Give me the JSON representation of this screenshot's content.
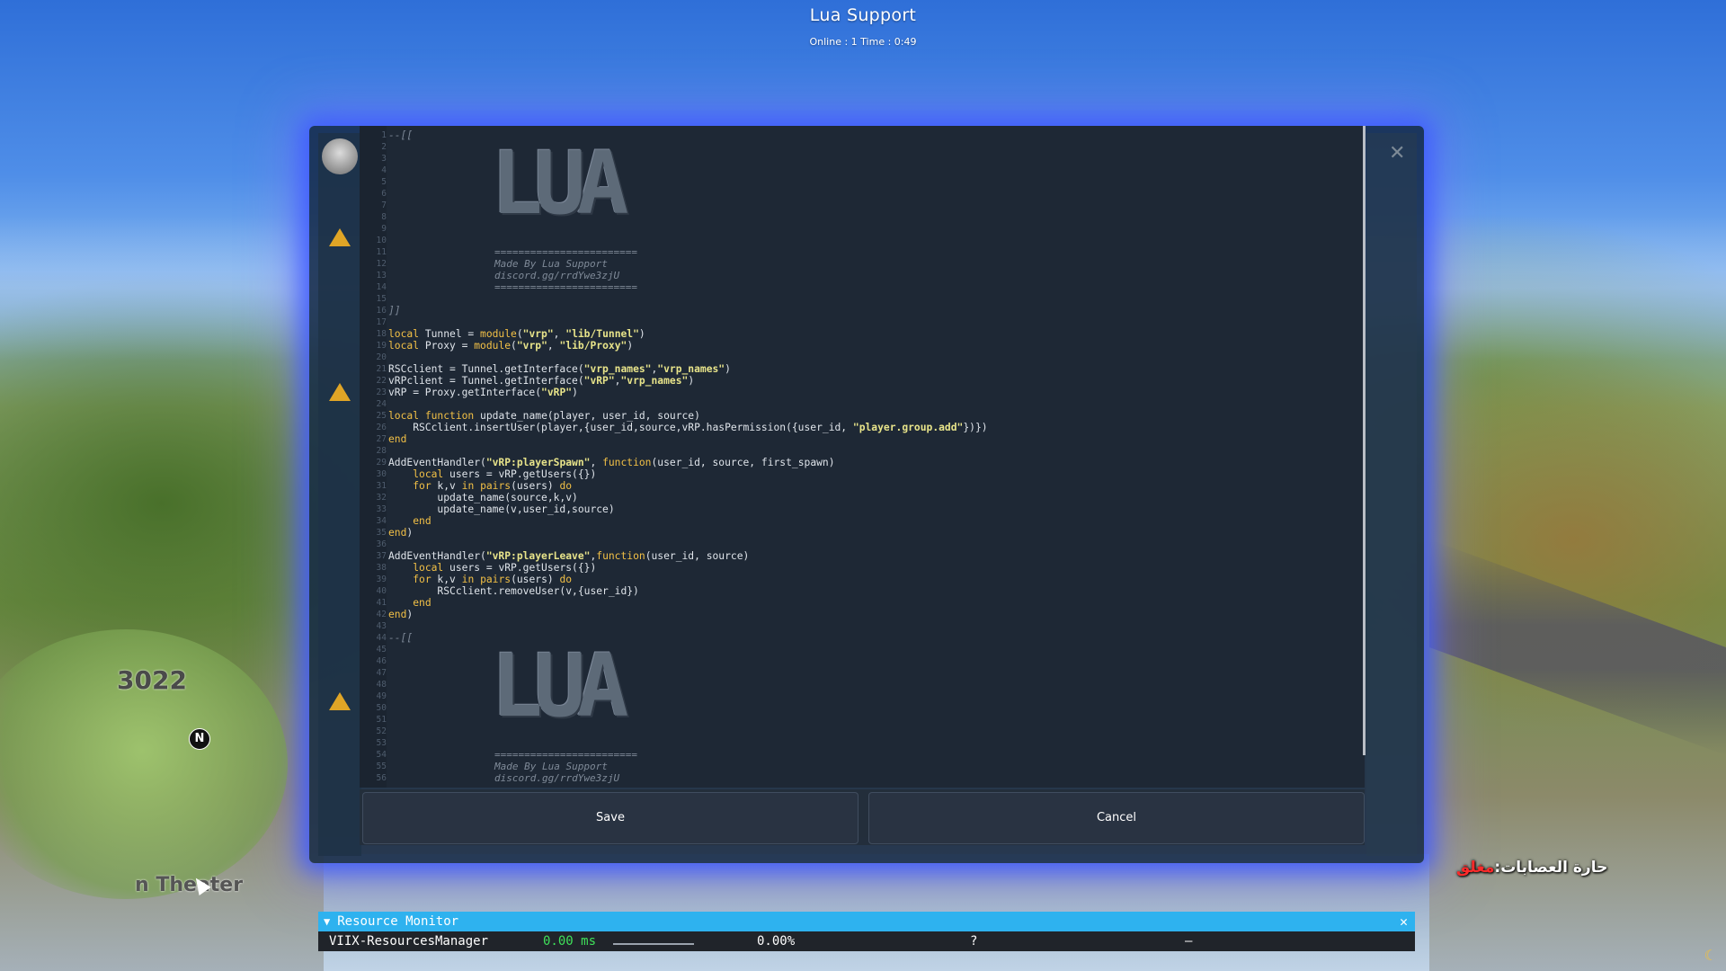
{
  "header": {
    "title": "Lua Support",
    "status": "Online : 1 Time : 0:49"
  },
  "editor": {
    "line_numbers": [
      "1",
      "2",
      "3",
      "4",
      "5",
      "6",
      "7",
      "8",
      "9",
      "10",
      "11",
      "12",
      "13",
      "14",
      "15",
      "16",
      "17",
      "18",
      "19",
      "20",
      "21",
      "22",
      "23",
      "24",
      "25",
      "26",
      "27",
      "28",
      "29",
      "30",
      "31",
      "32",
      "33",
      "34",
      "35",
      "36",
      "37",
      "38",
      "39",
      "40",
      "41",
      "42",
      "43",
      "44",
      "45",
      "46",
      "47",
      "48",
      "49",
      "50",
      "51",
      "52",
      "53",
      "54",
      "55",
      "56"
    ],
    "logo_text": "LUA",
    "banner_rule": "========================",
    "banner_author": "Made By Lua Support",
    "banner_link": "discord.gg/rrdYwe3zjU",
    "comment_open": "--[[",
    "comment_close": "]]",
    "code": {
      "l18_a": "local",
      "l18_b": " Tunnel = ",
      "l18_c": "module",
      "l18_d": "(",
      "l18_e": "\"vrp\"",
      "l18_f": ", ",
      "l18_g": "\"lib/Tunnel\"",
      "l18_h": ")",
      "l19_a": "local",
      "l19_b": " Proxy = ",
      "l19_c": "module",
      "l19_d": "(",
      "l19_e": "\"vrp\"",
      "l19_f": ", ",
      "l19_g": "\"lib/Proxy\"",
      "l19_h": ")",
      "l21_a": "RSCclient = Tunnel.getInterface(",
      "l21_b": "\"vrp_names\"",
      "l21_c": ",",
      "l21_d": "\"vrp_names\"",
      "l21_e": ")",
      "l22_a": "vRPclient = Tunnel.getInterface(",
      "l22_b": "\"vRP\"",
      "l22_c": ",",
      "l22_d": "\"vrp_names\"",
      "l22_e": ")",
      "l23_a": "vRP = Proxy.getInterface(",
      "l23_b": "\"vRP\"",
      "l23_c": ")",
      "l25_a": "local",
      "l25_b": " ",
      "l25_c": "function",
      "l25_d": " update_name(player, user_id, source)",
      "l26_a": "    RSCclient.insertUser(player,{user_id,source,vRP.hasPermission({user_id, ",
      "l26_b": "\"player.group.add\"",
      "l26_c": "})})",
      "l27_a": "end",
      "l29_a": "AddEventHandler(",
      "l29_b": "\"vRP:playerSpawn\"",
      "l29_c": ", ",
      "l29_d": "function",
      "l29_e": "(user_id, source, first_spawn)",
      "l30_a": "    ",
      "l30_b": "local",
      "l30_c": " users = vRP.getUsers({})",
      "l31_a": "    ",
      "l31_b": "for",
      "l31_c": " k,v ",
      "l31_d": "in",
      "l31_e": " ",
      "l31_f": "pairs",
      "l31_g": "(users) ",
      "l31_h": "do",
      "l32_a": "        update_name(source,k,v)",
      "l33_a": "        update_name(v,user_id,source)",
      "l34_a": "    ",
      "l34_b": "end",
      "l35_a": "end",
      "l35_b": ")",
      "l37_a": "AddEventHandler(",
      "l37_b": "\"vRP:playerLeave\"",
      "l37_c": ",",
      "l37_d": "function",
      "l37_e": "(user_id, source)",
      "l38_a": "    ",
      "l38_b": "local",
      "l38_c": " users = vRP.getUsers({})",
      "l39_a": "    ",
      "l39_b": "for",
      "l39_c": " k,v ",
      "l39_d": "in",
      "l39_e": " ",
      "l39_f": "pairs",
      "l39_g": "(users) ",
      "l39_h": "do",
      "l40_a": "        RSCclient.removeUser(v,{user_id})",
      "l41_a": "    ",
      "l41_b": "end",
      "l42_a": "end",
      "l42_b": ")"
    }
  },
  "buttons": {
    "save": "Save",
    "cancel": "Cancel"
  },
  "minimap": {
    "area_number": "3022",
    "place_label": "n Theater",
    "north": "N"
  },
  "hud": {
    "gang_label": "حارة العصابات:",
    "gang_state": "مغلق"
  },
  "resource_monitor": {
    "title": "Resource Monitor",
    "row": {
      "name": "VIIX-ResourcesManager",
      "ms": "0.00 ms",
      "percent": "0.00%",
      "unknown": "?",
      "dash": "–"
    }
  },
  "colors": {
    "accent_blue": "#2eb2ef",
    "keyword": "#f2c046",
    "string": "#e8e48a",
    "editor_bg": "#1e2835",
    "gang_closed": "#ff2a2a",
    "ms_green": "#3fe05a"
  }
}
